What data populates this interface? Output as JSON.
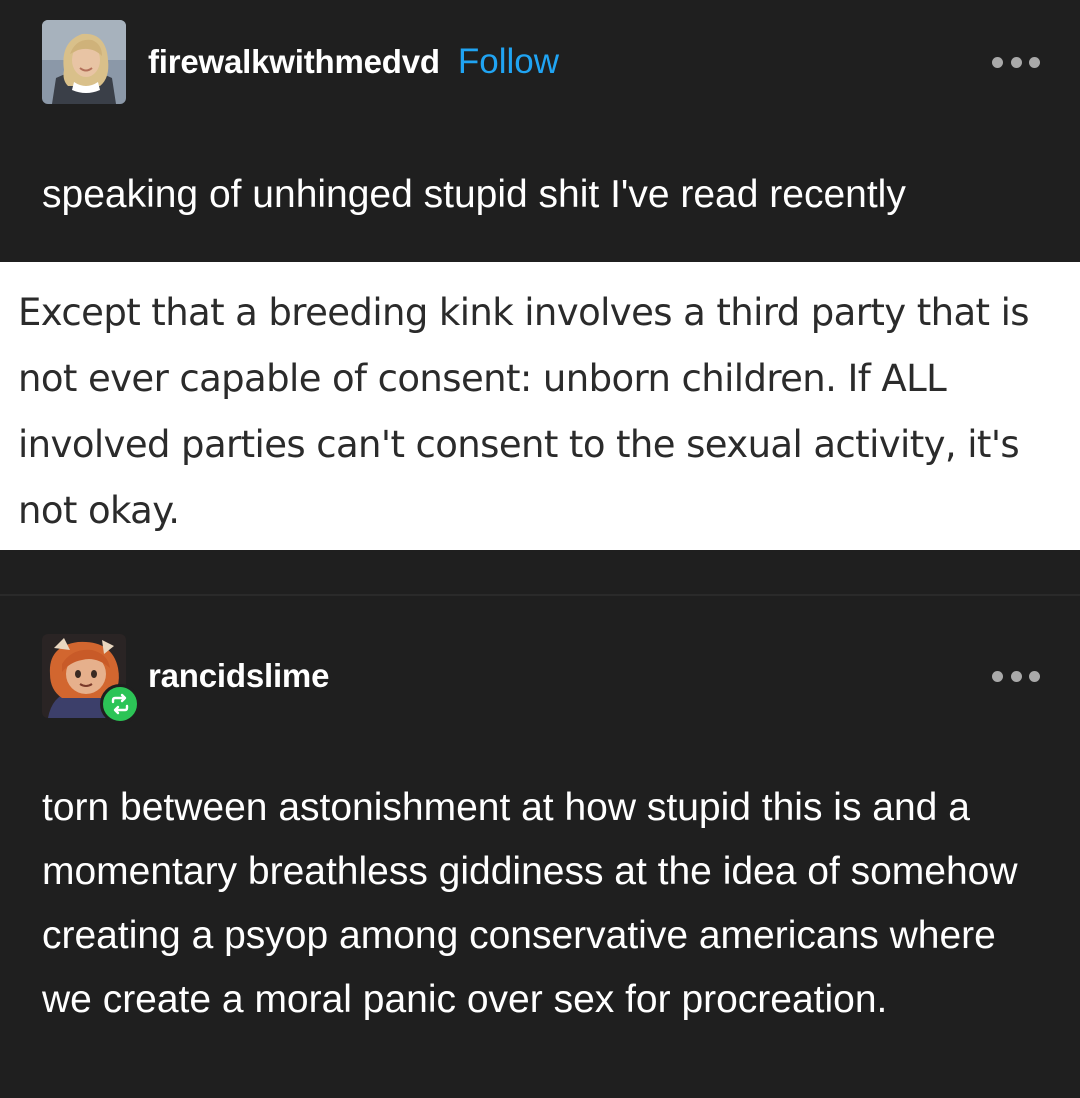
{
  "posts": [
    {
      "username": "firewalkwithmedvd",
      "follow_label": "Follow",
      "text": "speaking of unhinged stupid shit I've read recently",
      "quoted_image_text": "Except that a breeding kink involves a third party that is not ever capable of consent: unborn children. If ALL involved parties can't consent to the sexual activity, it's not okay."
    },
    {
      "username": "rancidslime",
      "text": "torn between astonishment at how stupid this is and a momentary breathless giddiness at the idea of somehow creating a psyop among conservative americans where we create a moral panic over sex for procreation."
    }
  ],
  "icons": {
    "more": "more-horizontal-icon",
    "reblog": "reblog-icon"
  },
  "colors": {
    "background": "#1f1f1f",
    "follow": "#20a4f3",
    "reblog_badge": "#2cc456",
    "quote_background": "#ffffff",
    "quote_text": "#2b2b2b"
  }
}
